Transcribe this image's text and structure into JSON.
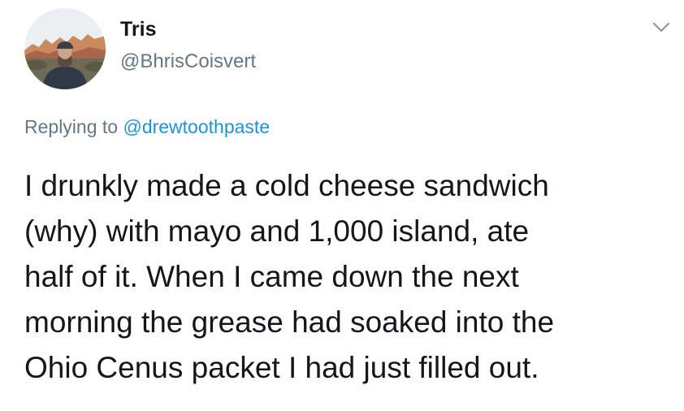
{
  "author": {
    "display_name": "Tris",
    "handle": "@BhrisCoisvert"
  },
  "menu": {
    "icon": "chevron-down-icon"
  },
  "reply": {
    "prefix": "Replying to",
    "mention": "@drewtoothpaste"
  },
  "tweet": {
    "lines": [
      "I drunkly made a cold cheese sandwich",
      "(why) with mayo and 1,000 island, ate",
      "half of it. When I came down the next",
      "morning the grease had soaked into the",
      "Ohio Cenus packet I had just filled out."
    ]
  },
  "colors": {
    "text": "#14171a",
    "secondary": "#657786",
    "link": "#1b95e0",
    "background": "#ffffff"
  }
}
